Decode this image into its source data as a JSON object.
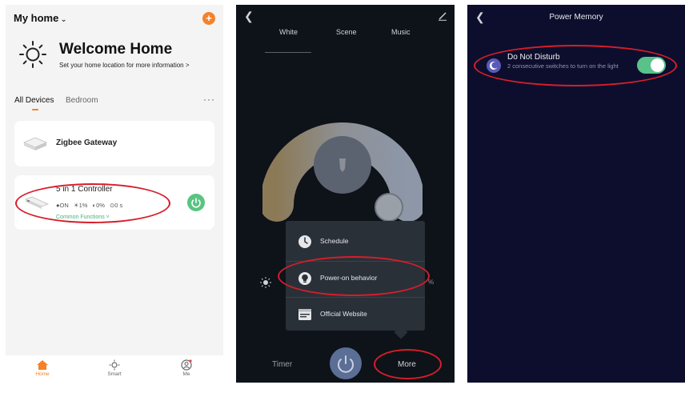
{
  "panel_home": {
    "home_selector": "My home",
    "add_icon": "plus-icon",
    "welcome": {
      "title": "Welcome Home",
      "subtitle": "Set your home location for more information  >"
    },
    "tabs": {
      "all": "All Devices",
      "bedroom": "Bedroom",
      "more": "···"
    },
    "devices": [
      {
        "name": "Zigbee Gateway"
      },
      {
        "name": "5 in 1 Controller",
        "stats": [
          "●ON",
          "☀1%",
          "◐0%",
          "⊙0 s"
        ],
        "common_functions": "Common Functions ˅"
      }
    ],
    "nav": [
      {
        "label": "Home",
        "icon": "home-icon"
      },
      {
        "label": "Smart",
        "icon": "sun-icon"
      },
      {
        "label": "Me",
        "icon": "user-icon"
      }
    ],
    "accent_color": "#f4822b",
    "highlight_color": "#d61e2b"
  },
  "panel_light": {
    "tabs": [
      "White",
      "Scene",
      "Music"
    ],
    "menu": [
      {
        "label": "Schedule",
        "icon": "clock-icon"
      },
      {
        "label": "Power-on behavior",
        "icon": "bulb-icon"
      },
      {
        "label": "Official Website",
        "icon": "browser-icon"
      }
    ],
    "percent_suffix": "%",
    "bottom": {
      "timer": "Timer",
      "more": "More"
    }
  },
  "panel_memory": {
    "title": "Power Memory",
    "dnd": {
      "title": "Do Not Disturb",
      "description": "2 consecutive switches to turn on the light",
      "enabled": true
    },
    "toggle_color": "#58c28a"
  }
}
